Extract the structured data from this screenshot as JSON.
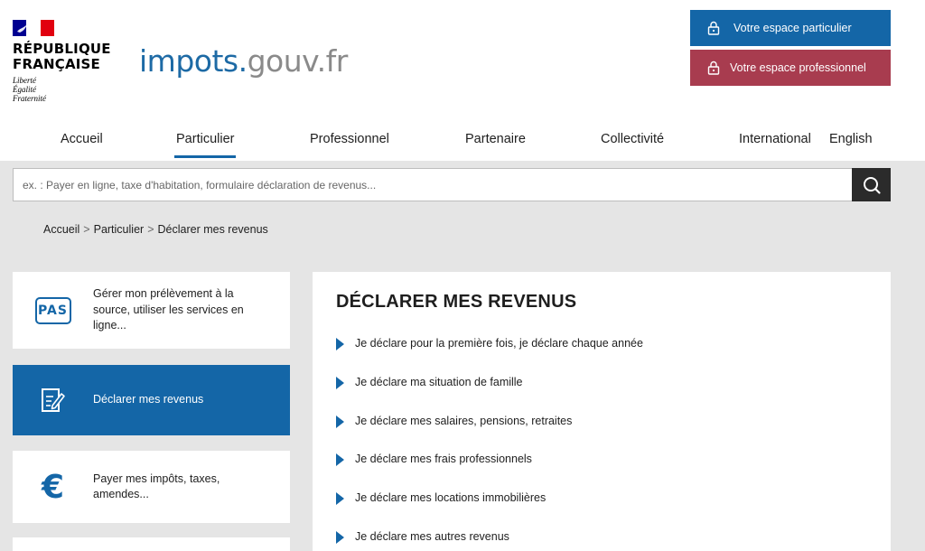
{
  "brand": {
    "republic_line1": "RÉPUBLIQUE",
    "republic_line2": "FRANÇAISE",
    "motto": [
      "Liberté",
      "Égalité",
      "Fraternité"
    ],
    "site_part1": "impots.",
    "site_part2": "gouv.fr",
    "colors": {
      "blue": "#1466a7",
      "red": "#a83c4f",
      "flag_blue": "#000091",
      "flag_red": "#e1000f"
    }
  },
  "account_buttons": {
    "particulier": {
      "label": "Votre espace particulier",
      "icon": "lock-icon"
    },
    "professionnel": {
      "label": "Votre espace professionnel",
      "icon": "lock-icon"
    }
  },
  "nav": {
    "items": [
      {
        "label": "Accueil"
      },
      {
        "label": "Particulier",
        "active": true
      },
      {
        "label": "Professionnel"
      },
      {
        "label": "Partenaire"
      },
      {
        "label": "Collectivité"
      },
      {
        "label": "International"
      },
      {
        "label": "English"
      }
    ]
  },
  "search": {
    "placeholder": "ex. : Payer en ligne, taxe d'habitation, formulaire déclaration de revenus...",
    "button_icon": "search-icon"
  },
  "breadcrumb": {
    "items": [
      "Accueil",
      "Particulier",
      "Déclarer mes revenus"
    ],
    "separator": ">"
  },
  "sidebar": {
    "cards": [
      {
        "label": "Gérer mon prélèvement à la source, utiliser les services en ligne...",
        "icon": "pas-icon",
        "icon_text": "PAS"
      },
      {
        "label": "Déclarer mes revenus",
        "icon": "declaration-form-icon",
        "active": true
      },
      {
        "label": "Payer mes impôts, taxes, amendes...",
        "icon": "euro-icon",
        "icon_text": "€"
      }
    ]
  },
  "main": {
    "title": "DÉCLARER MES REVENUS",
    "links": [
      "Je déclare pour la première fois, je déclare chaque année",
      "Je déclare ma situation de famille",
      "Je déclare mes salaires, pensions, retraites",
      "Je déclare mes frais professionnels",
      "Je déclare mes locations immobilières",
      "Je déclare mes autres revenus"
    ]
  }
}
